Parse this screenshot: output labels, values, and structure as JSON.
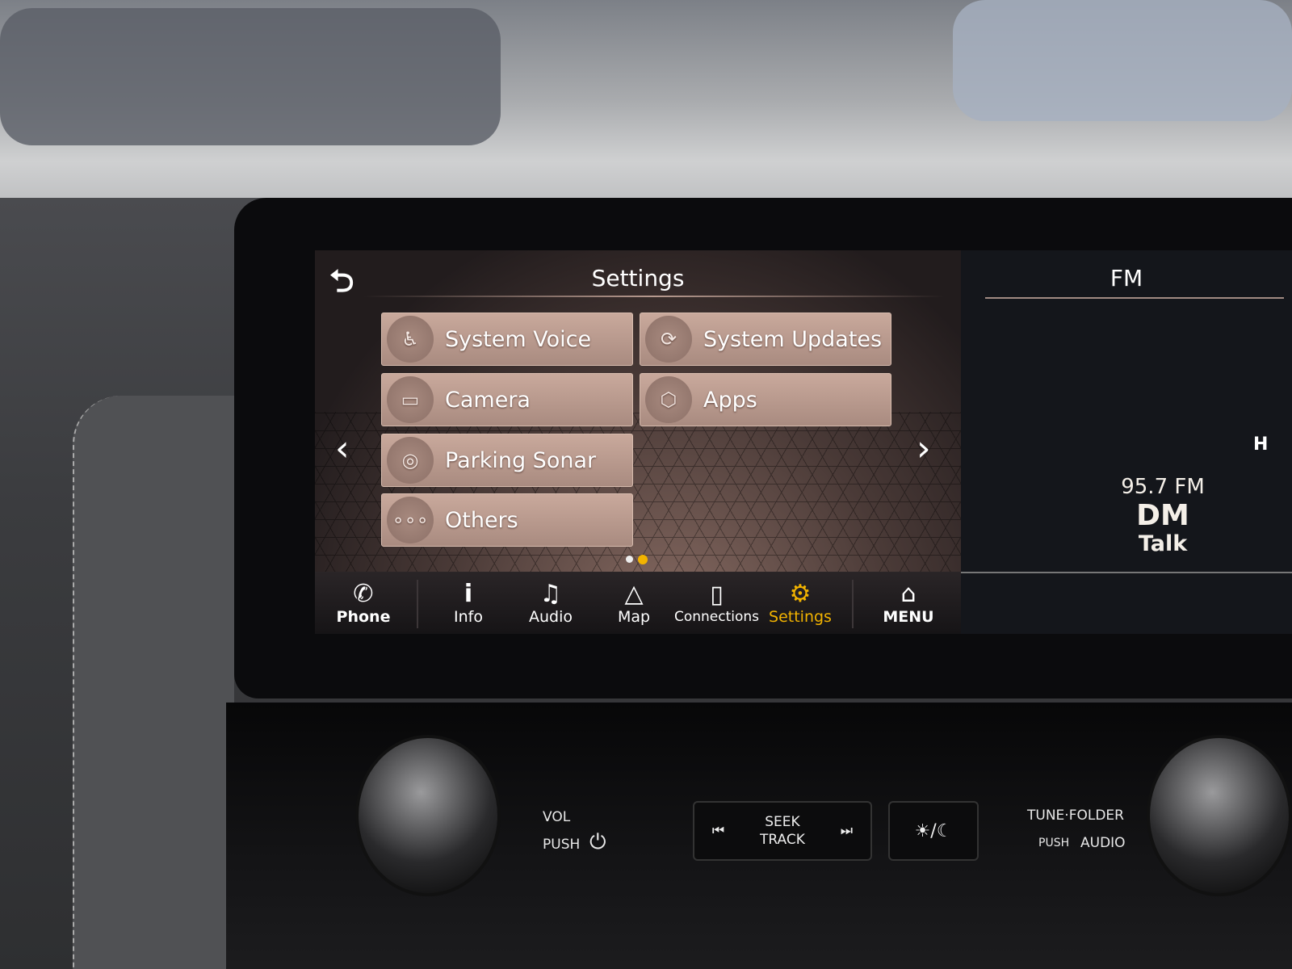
{
  "header": {
    "back_icon": "return-arrow-icon",
    "title": "Settings"
  },
  "tiles": [
    {
      "label": "System Voice",
      "icon": "voice-person-icon"
    },
    {
      "label": "System Updates",
      "icon": "update-screen-icon"
    },
    {
      "label": "Camera",
      "icon": "camera-icon"
    },
    {
      "label": "Apps",
      "icon": "cube-icon"
    },
    {
      "label": "Parking Sonar",
      "icon": "sonar-icon"
    },
    {
      "label": "Others",
      "icon": "ellipsis-icon"
    }
  ],
  "pagination": {
    "pages": 2,
    "current": 2
  },
  "nav": [
    {
      "label": "Phone",
      "icon": "phone-icon"
    },
    {
      "label": "Info",
      "icon": "info-icon"
    },
    {
      "label": "Audio",
      "icon": "music-note-icon"
    },
    {
      "label": "Map",
      "icon": "navigation-arrow-icon"
    },
    {
      "label": "Connections",
      "icon": "phone-signal-icon"
    },
    {
      "label": "Settings",
      "icon": "gear-icon",
      "active": true
    },
    {
      "label": "MENU",
      "icon": "home-icon"
    }
  ],
  "radio": {
    "band": "FM",
    "frequency": "95.7  FM",
    "station": "DM",
    "genre": "Talk",
    "edge_text": "H"
  },
  "controls": {
    "vol": "VOL",
    "push": "PUSH",
    "seek": "SEEK",
    "track": "TRACK",
    "tune_folder": "TUNE·FOLDER",
    "push2": "PUSH",
    "audio": "AUDIO",
    "day_night": "☀/☾"
  },
  "colors": {
    "accent": "#f2b300",
    "tile": "#b89a8e"
  }
}
